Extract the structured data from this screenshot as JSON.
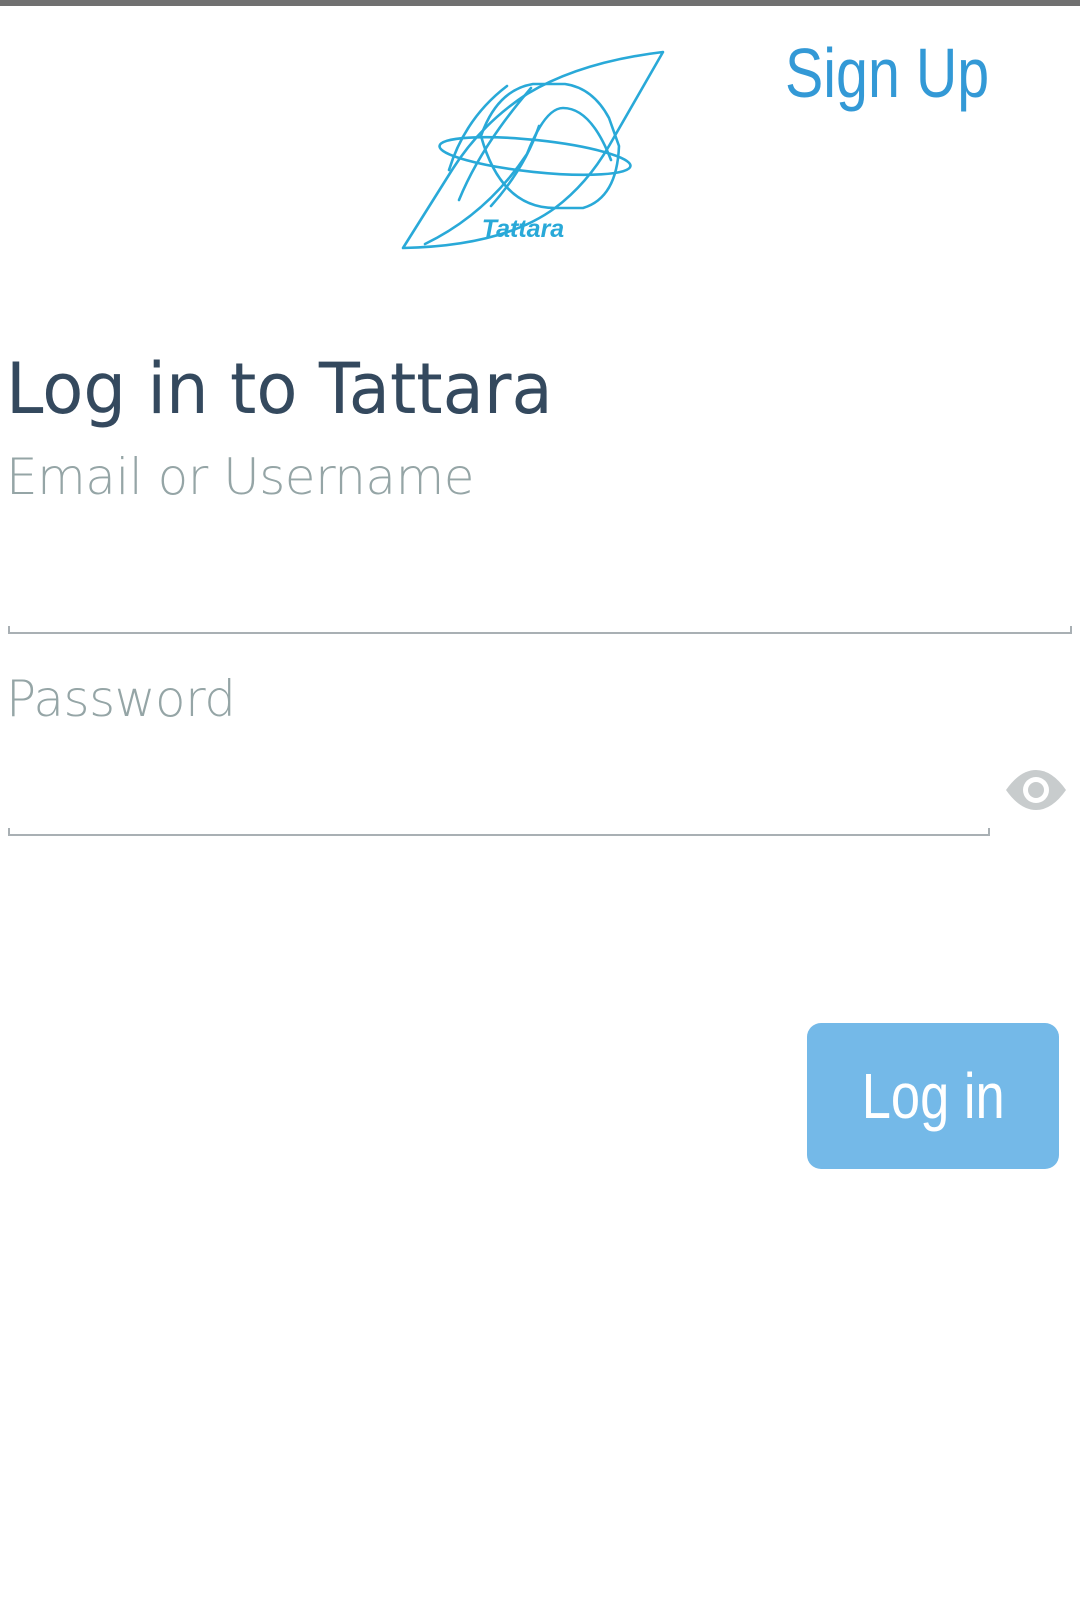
{
  "header": {
    "logo_text": "Tattara",
    "signup_label": "Sign Up"
  },
  "login": {
    "title": "Log in to Tattara",
    "email_label": "Email or Username",
    "email_value": "",
    "password_label": "Password",
    "password_value": "",
    "password_toggle_icon": "eye-icon",
    "submit_label": "Log in"
  },
  "colors": {
    "brand": "#29a9d8",
    "link": "#3399d6",
    "title": "#34495e",
    "label": "#95a5a6",
    "button": "#74b9e8",
    "icon": "#c8cccd"
  }
}
